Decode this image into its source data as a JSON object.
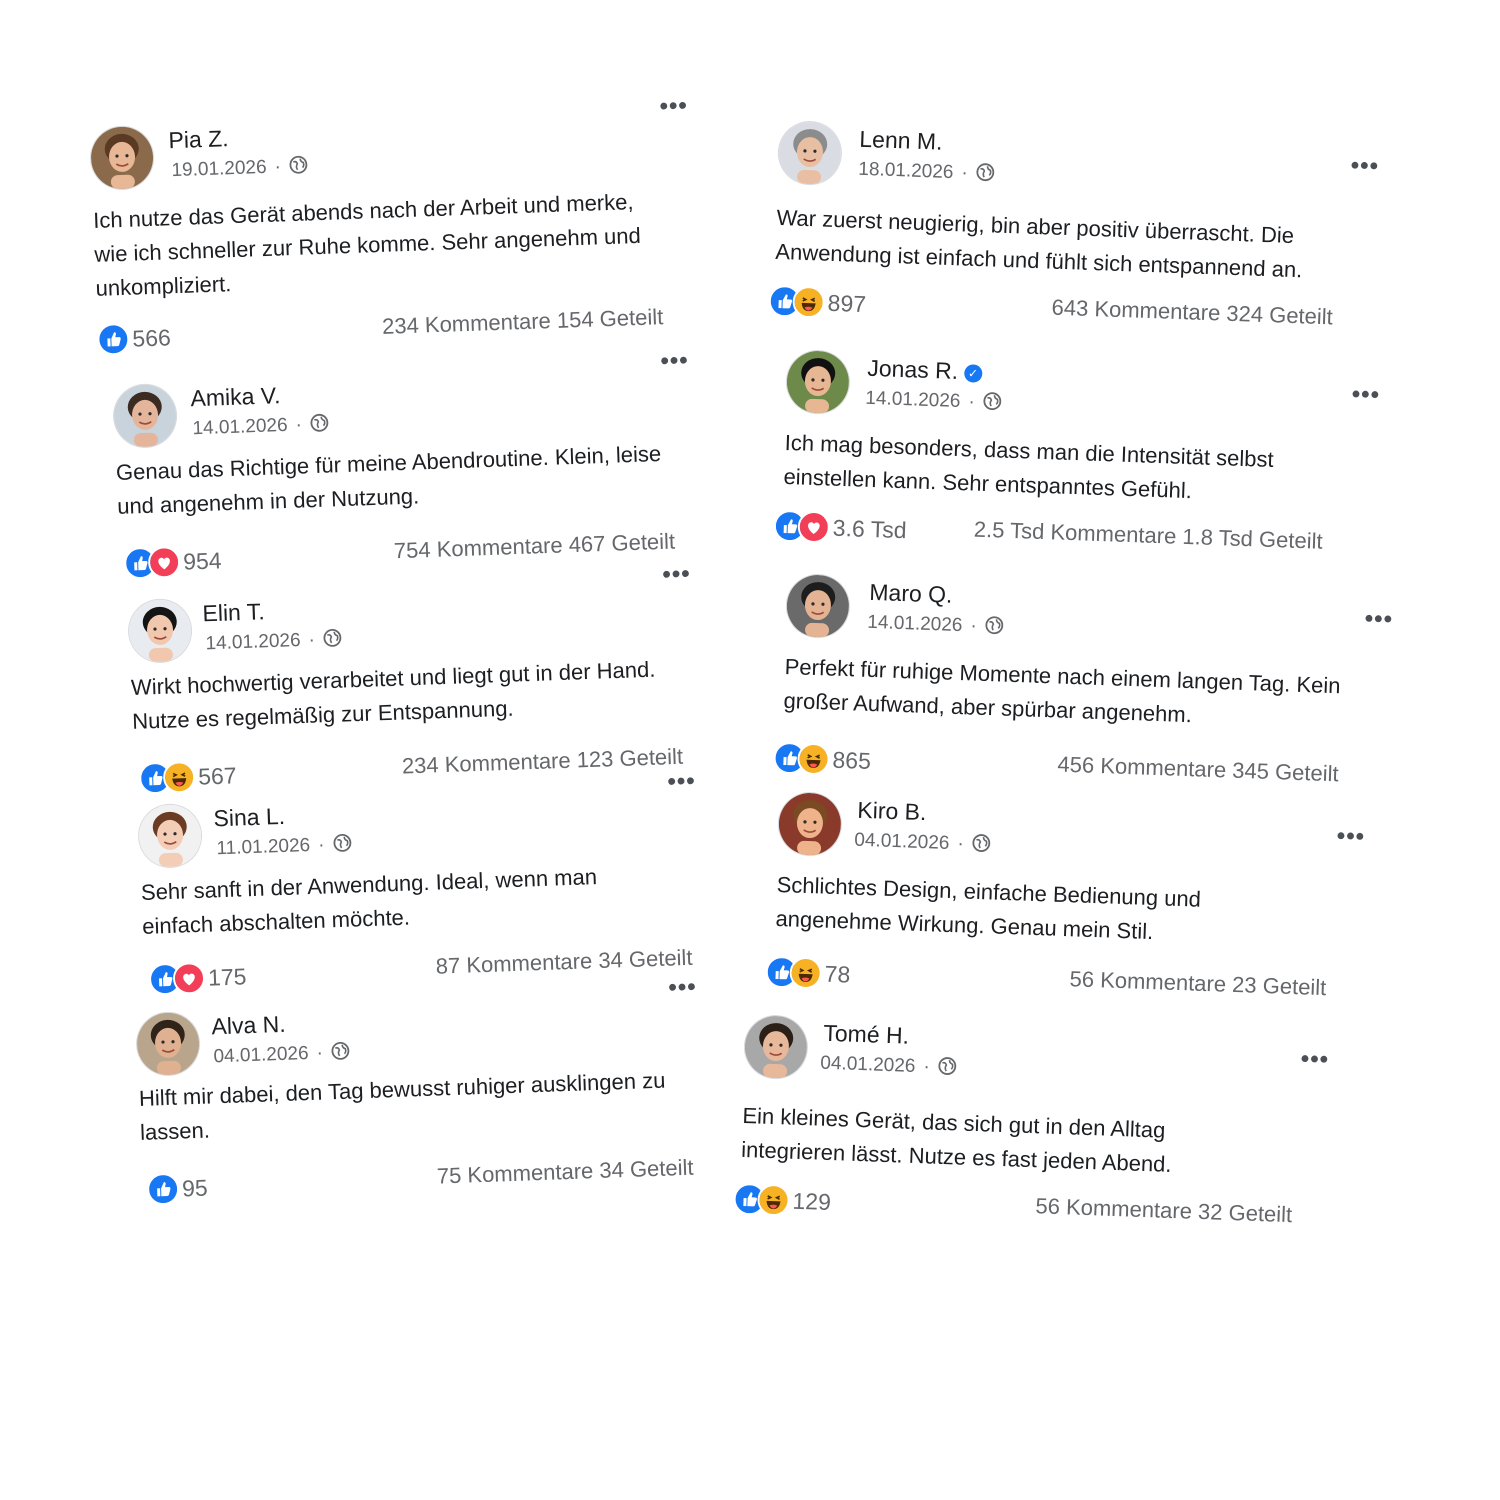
{
  "posts": [
    {
      "name": "Pia Z.",
      "date": "19.01.2026",
      "text": "Ich nutze das Gerät abends nach der Arbeit und merke, wie ich schneller zur Ruhe komme. Sehr angenehm und unkompliziert.",
      "reactions": [
        "like"
      ],
      "count": "566",
      "stats": "234 Kommentare 154 Geteilt",
      "verified": false
    },
    {
      "name": "Amika V.",
      "date": "14.01.2026",
      "text": "Genau das Richtige für meine Abendroutine. Klein, leise und angenehm in der Nutzung.",
      "reactions": [
        "like",
        "love"
      ],
      "count": "954",
      "stats": "754 Kommentare 467 Geteilt",
      "verified": false
    },
    {
      "name": "Elin T.",
      "date": "14.01.2026",
      "text": "Wirkt hochwertig verarbeitet und liegt gut in der Hand. Nutze es regelmäßig zur Entspannung.",
      "reactions": [
        "like",
        "haha"
      ],
      "count": "567",
      "stats": "234 Kommentare 123 Geteilt",
      "verified": false
    },
    {
      "name": "Sina L.",
      "date": "11.01.2026",
      "text": "Sehr sanft in der Anwendung. Ideal, wenn man einfach abschalten möchte.",
      "reactions": [
        "like",
        "love"
      ],
      "count": "175",
      "stats": "87 Kommentare 34 Geteilt",
      "verified": false
    },
    {
      "name": "Alva N.",
      "date": "04.01.2026",
      "text": "Hilft mir dabei, den Tag bewusst ruhiger ausklingen zu lassen.",
      "reactions": [
        "like"
      ],
      "count": "95",
      "stats": "75 Kommentare 34 Geteilt",
      "verified": false
    },
    {
      "name": "Lenn M.",
      "date": "18.01.2026",
      "text": "War zuerst neugierig, bin aber positiv überrascht. Die Anwendung ist einfach und fühlt sich entspannend an.",
      "reactions": [
        "like",
        "haha"
      ],
      "count": "897",
      "stats": "643 Kommentare 324 Geteilt",
      "verified": false
    },
    {
      "name": "Jonas R.",
      "date": "14.01.2026",
      "text": "Ich mag besonders, dass man die Intensität selbst einstellen kann. Sehr entspanntes Gefühl.",
      "reactions": [
        "like",
        "love"
      ],
      "count": "3.6 Tsd",
      "stats": "2.5 Tsd Kommentare 1.8 Tsd Geteilt",
      "verified": true
    },
    {
      "name": "Maro Q.",
      "date": "14.01.2026",
      "text": "Perfekt für ruhige Momente nach einem langen Tag. Kein großer Aufwand, aber spürbar angenehm.",
      "reactions": [
        "like",
        "haha"
      ],
      "count": "865",
      "stats": "456 Kommentare 345 Geteilt",
      "verified": false
    },
    {
      "name": "Kiro B.",
      "date": "04.01.2026",
      "text": "Schlichtes Design, einfache Bedienung und angenehme Wirkung. Genau mein Stil.",
      "reactions": [
        "like",
        "haha"
      ],
      "count": "78",
      "stats": "56 Kommentare 23 Geteilt",
      "verified": false
    },
    {
      "name": "Tomé H.",
      "date": "04.01.2026",
      "text": "Ein kleines Gerät, das sich gut in den Alltag integrieren lässt. Nutze es fast jeden Abend.",
      "reactions": [
        "like",
        "haha"
      ],
      "count": "129",
      "stats": "56 Kommentare 32 Geteilt",
      "verified": false
    }
  ],
  "separator": "·",
  "more_label": "•••",
  "colors": {
    "like": "#1877f2",
    "love": "#f33e58",
    "haha": "#f7b125",
    "meta": "#65676b"
  }
}
